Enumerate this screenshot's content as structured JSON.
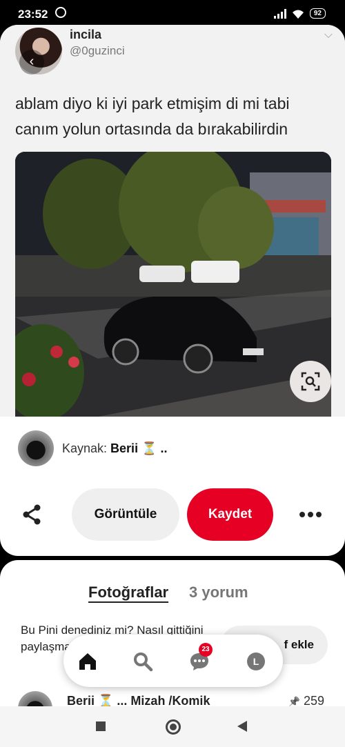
{
  "status_bar": {
    "time": "23:52",
    "battery": "92"
  },
  "tweet": {
    "name": "incila",
    "handle": "@0guzinci",
    "text": "ablam diyo ki iyi park etmişim di mi tabi canım yolun ortasında da bırakabilirdin",
    "back_glyph": "‹",
    "chevron_glyph": "⌵"
  },
  "source": {
    "label": "Kaynak:",
    "name": "Berii ⏳ .."
  },
  "actions": {
    "view_label": "Görüntüle",
    "save_label": "Kaydet"
  },
  "comments": {
    "tab_photos": "Fotoğraflar",
    "tab_comments": "3 yorum",
    "tried_text": "Bu Pini denediniz mi? Nasıl gittiğini paylaşmak için fotoğraf ekle",
    "add_photo_label": "f ekle",
    "pin_title": "Berii ⏳ ... Mizah /Komik",
    "pin_count": "259",
    "pin_glyph": "📌"
  },
  "bottom_nav": {
    "notif_count": "23",
    "profile_initial": "L"
  },
  "colors": {
    "accent": "#e60023",
    "text": "#222222",
    "muted": "#767676"
  }
}
